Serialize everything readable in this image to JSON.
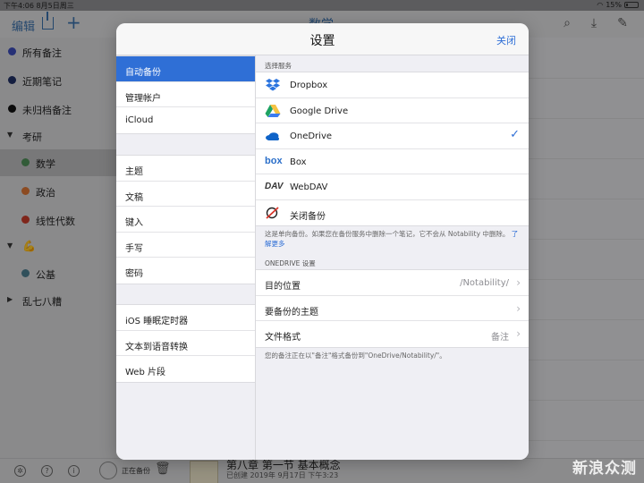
{
  "status_bar": {
    "time": "下午4:06",
    "date": "8月5日周三",
    "battery": "15%"
  },
  "background_app": {
    "edit_label": "编辑",
    "title": "数学",
    "sidebar": [
      {
        "label": "所有备注",
        "color": "#3b4bb5"
      },
      {
        "label": "近期笔记",
        "color": "#1f2f63"
      },
      {
        "label": "未归档备注",
        "color": "#111111"
      },
      {
        "label": "考研",
        "color": ""
      },
      {
        "label": "数学",
        "color": "#4d8c57"
      },
      {
        "label": "政治",
        "color": "#d77435"
      },
      {
        "label": "线性代数",
        "color": "#c43b2a"
      },
      {
        "label": "💪",
        "color": ""
      },
      {
        "label": "公基",
        "color": "#4a7c8d"
      },
      {
        "label": "乱七八糟",
        "color": ""
      }
    ],
    "bottom": {
      "backup_status": "正在备份",
      "note_title": "第八章 第一节 基本概念",
      "note_date": "已创建 2019年 9月17日 下午3:23"
    }
  },
  "modal": {
    "title": "设置",
    "close_label": "关闭",
    "menu_groups": [
      [
        "自动备份",
        "管理帐户",
        "iCloud"
      ],
      [
        "主题",
        "文稿",
        "键入",
        "手写",
        "密码"
      ],
      [
        "iOS 睡眠定时器",
        "文本到语音转换",
        "Web 片段"
      ]
    ],
    "selected_menu": "自动备份",
    "select_service_header": "选择服务",
    "services": [
      {
        "label": "Dropbox",
        "icon": "dropbox-icon",
        "checked": false
      },
      {
        "label": "Google Drive",
        "icon": "google-drive-icon",
        "checked": false
      },
      {
        "label": "OneDrive",
        "icon": "onedrive-icon",
        "checked": true
      },
      {
        "label": "Box",
        "icon": "box-icon",
        "checked": false
      },
      {
        "label": "WebDAV",
        "icon": "webdav-icon",
        "checked": false
      },
      {
        "label": "关闭备份",
        "icon": "backup-off-icon",
        "checked": false
      }
    ],
    "one_way_note": "这是单向备份。如果您在备份服务中删除一个笔记，它不会从 Notability 中删除。",
    "learn_more": "了解更多",
    "onedrive_header": "ONEDRIVE 设置",
    "onedrive_settings": [
      {
        "label": "目的位置",
        "value": "/Notability/"
      },
      {
        "label": "要备份的主题",
        "value": ""
      },
      {
        "label": "文件格式",
        "value": "备注"
      }
    ],
    "footer_note": "您的备注正在以\"备注\"格式备份到\"OneDrive/Notability/\"。"
  },
  "watermark": "新浪众测"
}
